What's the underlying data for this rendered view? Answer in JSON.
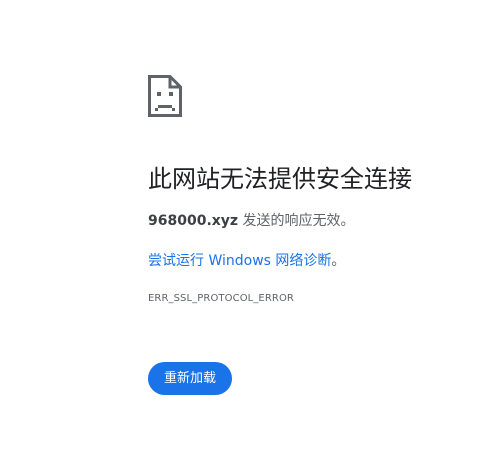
{
  "error_page": {
    "icon": "sad-document-icon",
    "title": "此网站无法提供安全连接",
    "hostname": "968000.xyz",
    "description_suffix": " 发送的响应无效。",
    "suggestion_link": "尝试运行 Windows 网络诊断",
    "suggestion_suffix": "。",
    "error_code": "ERR_SSL_PROTOCOL_ERROR",
    "reload_label": "重新加载"
  },
  "colors": {
    "accent": "#1a73e8",
    "title_text": "#202124",
    "body_text": "#5f6368",
    "icon": "#5f6368"
  }
}
